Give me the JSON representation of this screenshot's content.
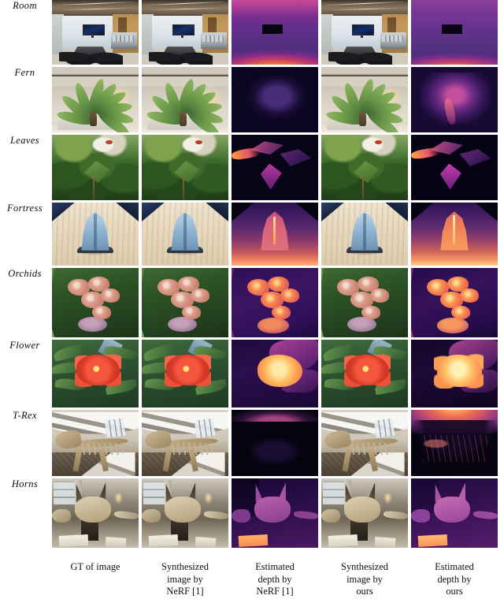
{
  "figure": {
    "type": "qualitative-comparison-grid",
    "rows": 8,
    "columns": 5
  },
  "row_labels": [
    "Room",
    "Fern",
    "Leaves",
    "Fortress",
    "Orchids",
    "Flower",
    "T-Rex",
    "Horns"
  ],
  "column_labels": [
    {
      "lines": [
        "GT of image"
      ]
    },
    {
      "lines": [
        "Synthesized",
        "image by",
        "NeRF [1]"
      ]
    },
    {
      "lines": [
        "Estimated",
        "depth by",
        "NeRF [1]"
      ]
    },
    {
      "lines": [
        "Synthesized",
        "image by",
        "ours"
      ]
    },
    {
      "lines": [
        "Estimated",
        "depth by",
        "ours"
      ]
    }
  ],
  "column_kinds": [
    "photo",
    "photo",
    "depth",
    "photo",
    "depth"
  ],
  "colors": {
    "page_background": "#ffffff",
    "text": "#121212",
    "depth_colormap": "inferno",
    "depth_low": "#02020a",
    "depth_mid": "#7a2a8a",
    "depth_high": "#ffc14a"
  },
  "cells": [
    {
      "scene": "Room",
      "gt": {
        "kind": "photo",
        "alt": "conference room with display and long table"
      },
      "nerf_image": {
        "kind": "photo",
        "alt": "conference room synthesized by NeRF"
      },
      "nerf_depth": {
        "kind": "depth",
        "alt": "magenta-purple room depth with bright orange foreground"
      },
      "ours_image": {
        "kind": "photo",
        "alt": "conference room synthesized by ours"
      },
      "ours_depth": {
        "kind": "depth",
        "alt": "purple room depth with bright orange foreground"
      }
    },
    {
      "scene": "Fern",
      "gt": {
        "kind": "photo",
        "alt": "potted fern in a lobby atrium"
      },
      "nerf_image": {
        "kind": "photo",
        "alt": "fern synthesized by NeRF"
      },
      "nerf_depth": {
        "kind": "depth",
        "alt": "very dark navy depth, fern barely visible"
      },
      "ours_image": {
        "kind": "photo",
        "alt": "fern synthesized by ours"
      },
      "ours_depth": {
        "kind": "depth",
        "alt": "bright magenta-purple fern depth"
      }
    },
    {
      "scene": "Leaves",
      "gt": {
        "kind": "photo",
        "alt": "dense green foliage with large leaf"
      },
      "nerf_image": {
        "kind": "photo",
        "alt": "leaves synthesized by NeRF"
      },
      "nerf_depth": {
        "kind": "depth",
        "alt": "dark depth with magenta leaf shapes and orange edge"
      },
      "ours_image": {
        "kind": "photo",
        "alt": "leaves synthesized by ours"
      },
      "ours_depth": {
        "kind": "depth",
        "alt": "dark depth with magenta leaf shapes and orange edge"
      }
    },
    {
      "scene": "Fortress",
      "gt": {
        "kind": "photo",
        "alt": "blue toy fortress on wooden table"
      },
      "nerf_image": {
        "kind": "photo",
        "alt": "fortress synthesized by NeRF"
      },
      "nerf_depth": {
        "kind": "depth",
        "alt": "purple to orange gradient with pink fortress"
      },
      "ours_image": {
        "kind": "photo",
        "alt": "fortress synthesized by ours"
      },
      "ours_depth": {
        "kind": "depth",
        "alt": "purple to yellow gradient with bright orange fortress"
      }
    },
    {
      "scene": "Orchids",
      "gt": {
        "kind": "photo",
        "alt": "pink orchids with green blades"
      },
      "nerf_image": {
        "kind": "photo",
        "alt": "orchids synthesized by NeRF"
      },
      "nerf_depth": {
        "kind": "depth",
        "alt": "purple background with orange orchid blooms"
      },
      "ours_image": {
        "kind": "photo",
        "alt": "orchids synthesized by ours"
      },
      "ours_depth": {
        "kind": "depth",
        "alt": "darker purple background with orange orchid blooms"
      }
    },
    {
      "scene": "Flower",
      "gt": {
        "kind": "photo",
        "alt": "red-orange flower cluster among green leaves"
      },
      "nerf_image": {
        "kind": "photo",
        "alt": "flower synthesized by NeRF"
      },
      "nerf_depth": {
        "kind": "depth",
        "alt": "dark purple with bright yellow-orange bloom"
      },
      "ours_image": {
        "kind": "photo",
        "alt": "flower synthesized by ours"
      },
      "ours_depth": {
        "kind": "depth",
        "alt": "darker purple with bright yellow-orange bloom"
      }
    },
    {
      "scene": "T-Rex",
      "gt": {
        "kind": "photo",
        "alt": "T-Rex skeleton in museum hall with ramp"
      },
      "nerf_image": {
        "kind": "photo",
        "alt": "T-Rex synthesized by NeRF"
      },
      "nerf_depth": {
        "kind": "depth",
        "alt": "almost entirely black depth with faint purple band on top"
      },
      "ours_image": {
        "kind": "photo",
        "alt": "T-Rex synthesized by ours"
      },
      "ours_depth": {
        "kind": "depth",
        "alt": "bright orange-magenta arc over dark skeleton"
      }
    },
    {
      "scene": "Horns",
      "gt": {
        "kind": "photo",
        "alt": "triceratops skull on pedestal in museum"
      },
      "nerf_image": {
        "kind": "photo",
        "alt": "horns synthesized by NeRF"
      },
      "nerf_depth": {
        "kind": "depth",
        "alt": "purple depth with magenta skull and orange placard"
      },
      "ours_image": {
        "kind": "photo",
        "alt": "horns synthesized by ours"
      },
      "ours_depth": {
        "kind": "depth",
        "alt": "brighter purple depth with magenta skull and orange placard"
      }
    }
  ]
}
